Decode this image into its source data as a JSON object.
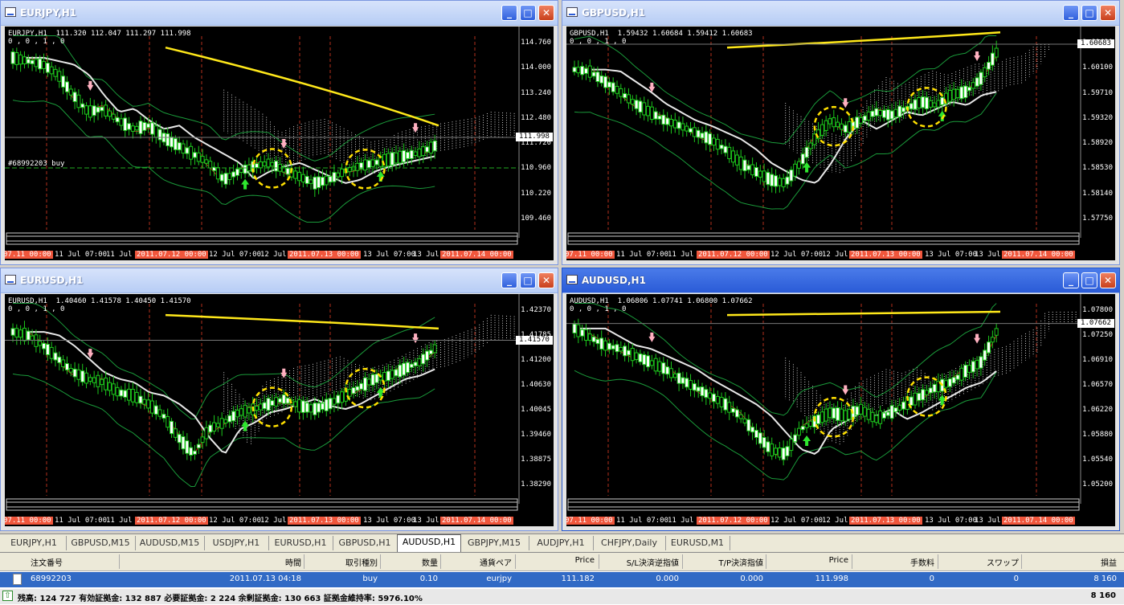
{
  "windows": [
    {
      "id": "eurjpy",
      "title": "EURJPY,H1",
      "active": false,
      "ohlc": "EURJPY,H1  111.320 112.047 111.297 111.998",
      "sub": "0 , 0 , 1 , 0",
      "order_label": "#68992203 buy",
      "prices": [
        "114.760",
        "114.000",
        "113.240",
        "112.480",
        "111.720",
        "110.960",
        "110.220",
        "109.460"
      ],
      "current_price": "111.998",
      "times": [
        "07.11 00:00",
        "11 Jul 07:00",
        "11 Jul 15",
        "2011.07.12 00:00",
        "12 Jul 07:00",
        "12 Jul 15",
        "2011.07.13 00:00",
        "13 Jul 07:00",
        "13 Jul 15",
        "2011.07.14 00:00"
      ]
    },
    {
      "id": "gbpusd",
      "title": "GBPUSD,H1",
      "active": false,
      "ohlc": "GBPUSD,H1  1.59432 1.60684 1.59412 1.60683",
      "sub": "0 , 0 , 1 , 0",
      "order_label": "",
      "prices": [
        "1.60490",
        "1.60100",
        "1.59710",
        "1.59320",
        "1.58920",
        "1.58530",
        "1.58140",
        "1.57750"
      ],
      "current_price": "1.60683",
      "times": [
        "07.11 00:00",
        "11 Jul 07:00",
        "11 Jul 15",
        "2011.07.12 00:00",
        "12 Jul 07:00",
        "12 Jul 15",
        "2011.07.13 00:00",
        "13 Jul 07:00",
        "13 Jul 15",
        "2011.07.14 00:00"
      ]
    },
    {
      "id": "eurusd",
      "title": "EURUSD,H1",
      "active": false,
      "ohlc": "EURUSD,H1  1.40460 1.41578 1.40450 1.41570",
      "sub": "0 , 0 , 1 , 0",
      "order_label": "",
      "prices": [
        "1.42370",
        "1.41785",
        "1.41200",
        "1.40630",
        "1.40045",
        "1.39460",
        "1.38875",
        "1.38290"
      ],
      "current_price": "1.41570",
      "times": [
        "07.11 00:00",
        "11 Jul 07:00",
        "11 Jul 15",
        "2011.07.12 00:00",
        "12 Jul 07:00",
        "12 Jul 15",
        "2011.07.13 00:00",
        "13 Jul 07:00",
        "13 Jul 15",
        "2011.07.14 00:00"
      ]
    },
    {
      "id": "audusd",
      "title": "AUDUSD,H1",
      "active": true,
      "ohlc": "AUDUSD,H1  1.06806 1.07741 1.06800 1.07662",
      "sub": "0 , 0 , 1 , 0",
      "order_label": "",
      "prices": [
        "1.07800",
        "1.07250",
        "1.06910",
        "1.06570",
        "1.06220",
        "1.05880",
        "1.05540",
        "1.05200"
      ],
      "current_price": "1.07662",
      "times": [
        "07.11 00:00",
        "11 Jul 07:00",
        "11 Jul 15",
        "2011.07.12 00:00",
        "12 Jul 07:00",
        "12 Jul 15",
        "2011.07.13 00:00",
        "13 Jul 07:00",
        "13 Jul 15",
        "2011.07.14 00:00"
      ]
    }
  ],
  "tabs": [
    "EURJPY,H1",
    "GBPUSD,M15",
    "AUDUSD,M15",
    "USDJPY,H1",
    "EURUSD,H1",
    "GBPUSD,H1",
    "AUDUSD,H1",
    "GBPJPY,M15",
    "AUDJPY,H1",
    "CHFJPY,Daily",
    "EURUSD,M1"
  ],
  "active_tab": "AUDUSD,H1",
  "terminal": {
    "headers": [
      "注文番号",
      "時間",
      "取引種別",
      "数量",
      "通貨ペア",
      "Price",
      "S/L決済逆指値",
      "T/P決済指値",
      "Price",
      "手数料",
      "スワップ",
      "損益"
    ],
    "row": [
      "68992203",
      "2011.07.13 04:18",
      "buy",
      "0.10",
      "eurjpy",
      "111.182",
      "0.000",
      "0.000",
      "111.998",
      "0",
      "0",
      "8 160"
    ],
    "balance_line": "残高: 124 727  有効証拠金: 132 887  必要証拠金: 2 224  余剰証拠金: 130 663  証拠金維持率: 5976.10%",
    "total_profit": "8 160"
  }
}
